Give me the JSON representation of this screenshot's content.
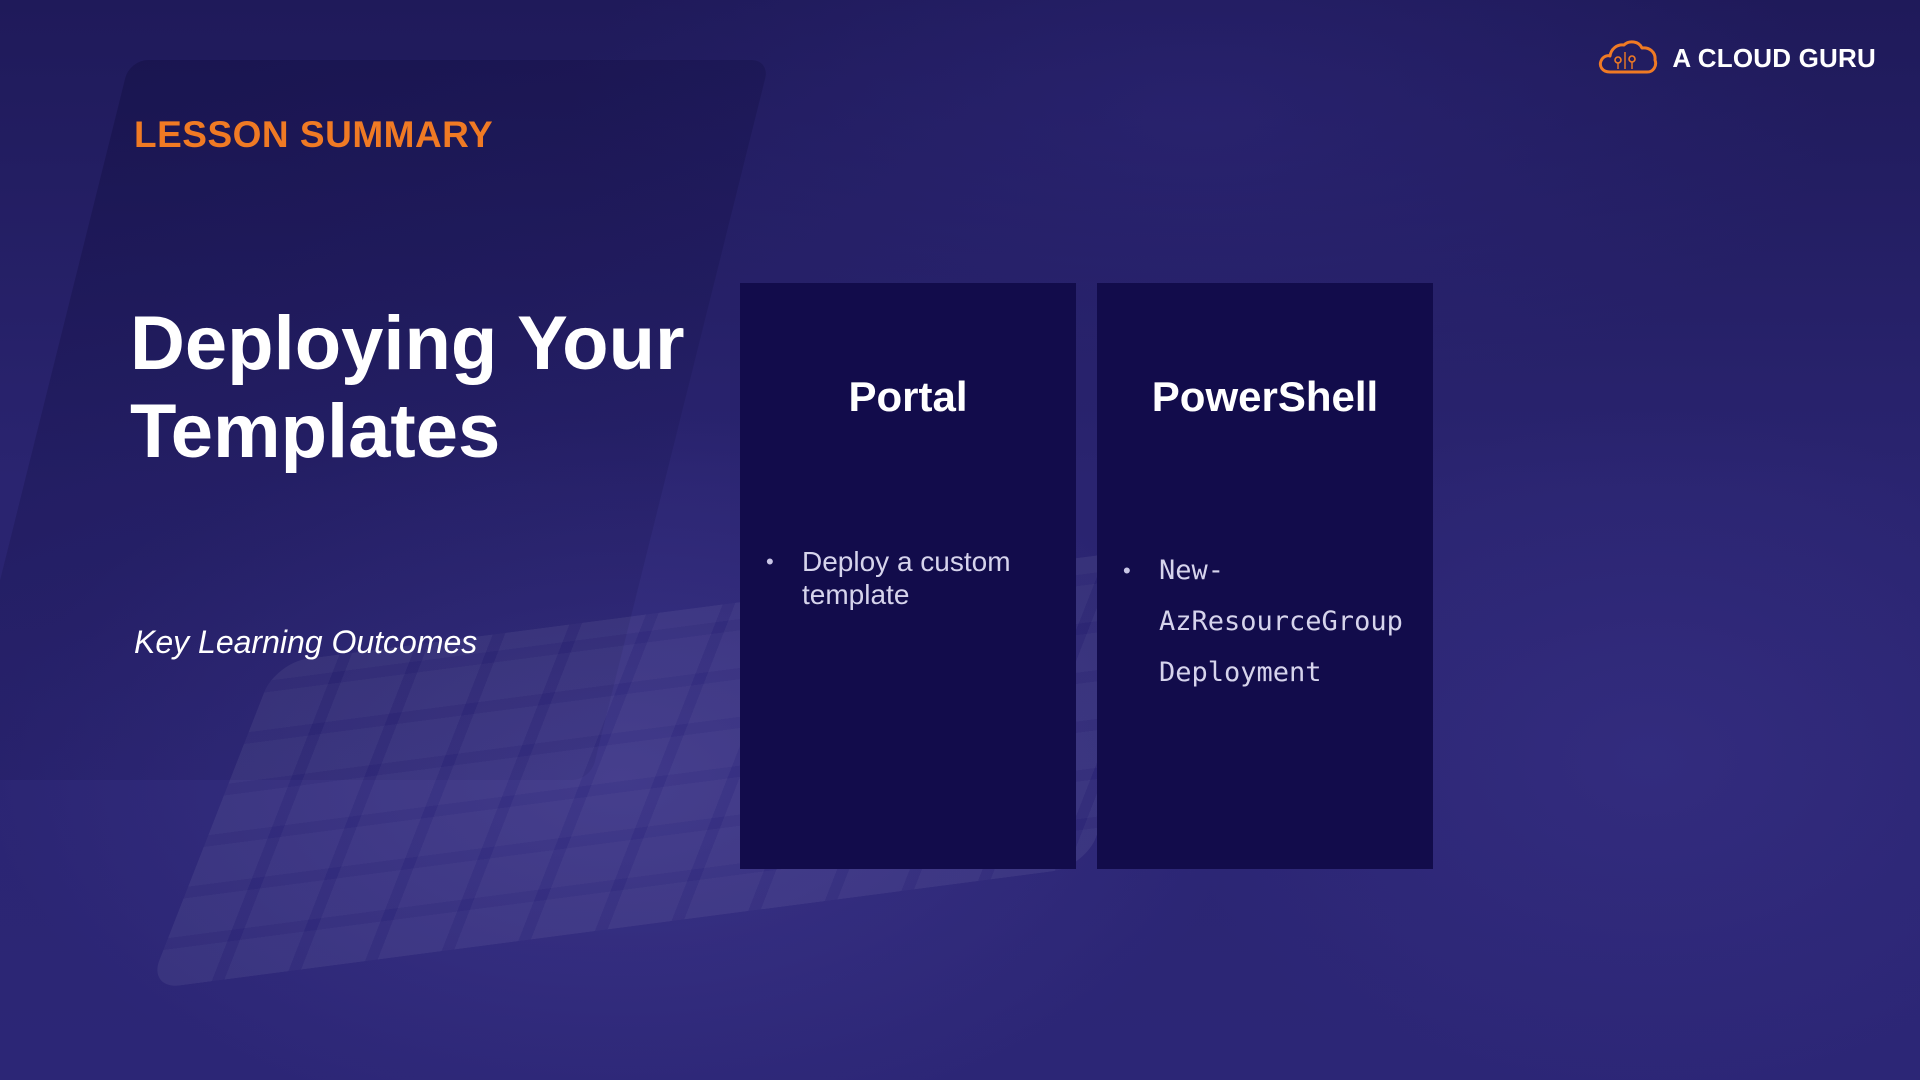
{
  "brand": {
    "name": "A CLOUD GURU",
    "logo_icon": "cloud-icon",
    "accent_color": "#f07a24"
  },
  "slide": {
    "section_label": "LESSON SUMMARY",
    "title": "Deploying Your Templates",
    "subtitle": "Key Learning Outcomes",
    "background_color": "#231d62",
    "card_color": "#120c4b"
  },
  "cards": [
    {
      "title": "Portal",
      "items": [
        "Deploy a custom template"
      ]
    },
    {
      "title": "PowerShell",
      "items": [
        "New-\nAzResourceGroup\nDeployment"
      ]
    }
  ]
}
